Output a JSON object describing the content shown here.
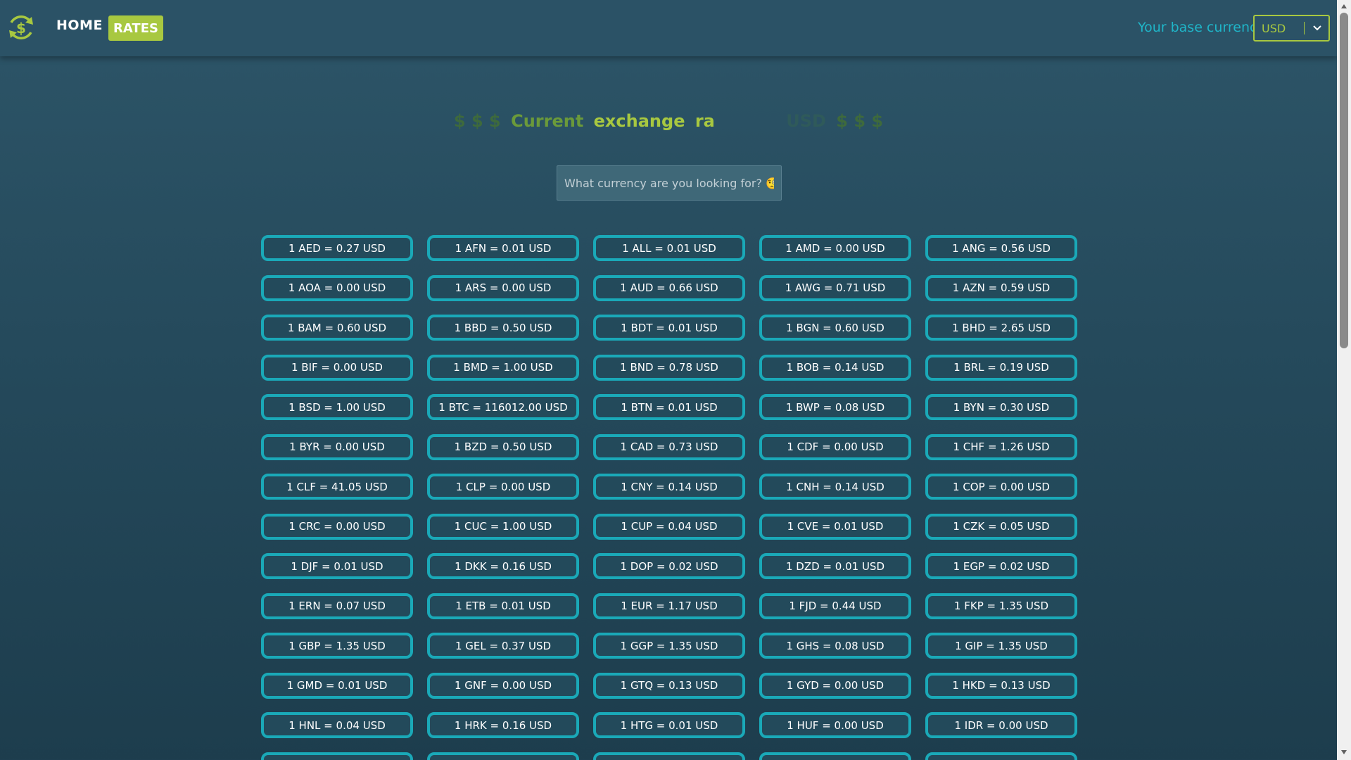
{
  "nav": {
    "home_label": "HOME",
    "rates_label": "RATES",
    "base_currency_label": "Your base currency:",
    "base_currency_value": "USD"
  },
  "title": {
    "prefix": "$ $ $",
    "word1": "Current",
    "word2": "exchange",
    "word3": "ra",
    "suffix_currency": "USD",
    "suffix": "$ $ $"
  },
  "search": {
    "placeholder": "What currency are you looking for? 🧐"
  },
  "rates": [
    "1 AED = 0.27 USD",
    "1 AFN = 0.01 USD",
    "1 ALL = 0.01 USD",
    "1 AMD = 0.00 USD",
    "1 ANG = 0.56 USD",
    "1 AOA = 0.00 USD",
    "1 ARS = 0.00 USD",
    "1 AUD = 0.66 USD",
    "1 AWG = 0.71 USD",
    "1 AZN = 0.59 USD",
    "1 BAM = 0.60 USD",
    "1 BBD = 0.50 USD",
    "1 BDT = 0.01 USD",
    "1 BGN = 0.60 USD",
    "1 BHD = 2.65 USD",
    "1 BIF = 0.00 USD",
    "1 BMD = 1.00 USD",
    "1 BND = 0.78 USD",
    "1 BOB = 0.14 USD",
    "1 BRL = 0.19 USD",
    "1 BSD = 1.00 USD",
    "1 BTC = 116012.00 USD",
    "1 BTN = 0.01 USD",
    "1 BWP = 0.08 USD",
    "1 BYN = 0.30 USD",
    "1 BYR = 0.00 USD",
    "1 BZD = 0.50 USD",
    "1 CAD = 0.73 USD",
    "1 CDF = 0.00 USD",
    "1 CHF = 1.26 USD",
    "1 CLF = 41.05 USD",
    "1 CLP = 0.00 USD",
    "1 CNY = 0.14 USD",
    "1 CNH = 0.14 USD",
    "1 COP = 0.00 USD",
    "1 CRC = 0.00 USD",
    "1 CUC = 1.00 USD",
    "1 CUP = 0.04 USD",
    "1 CVE = 0.01 USD",
    "1 CZK = 0.05 USD",
    "1 DJF = 0.01 USD",
    "1 DKK = 0.16 USD",
    "1 DOP = 0.02 USD",
    "1 DZD = 0.01 USD",
    "1 EGP = 0.02 USD",
    "1 ERN = 0.07 USD",
    "1 ETB = 0.01 USD",
    "1 EUR = 1.17 USD",
    "1 FJD = 0.44 USD",
    "1 FKP = 1.35 USD",
    "1 GBP = 1.35 USD",
    "1 GEL = 0.37 USD",
    "1 GGP = 1.35 USD",
    "1 GHS = 0.08 USD",
    "1 GIP = 1.35 USD",
    "1 GMD = 0.01 USD",
    "1 GNF = 0.00 USD",
    "1 GTQ = 0.13 USD",
    "1 GYD = 0.00 USD",
    "1 HKD = 0.13 USD",
    "1 HNL = 0.04 USD",
    "1 HRK = 0.16 USD",
    "1 HTG = 0.01 USD",
    "1 HUF = 0.00 USD",
    "1 IDR = 0.00 USD",
    "",
    "",
    "",
    "",
    ""
  ]
}
